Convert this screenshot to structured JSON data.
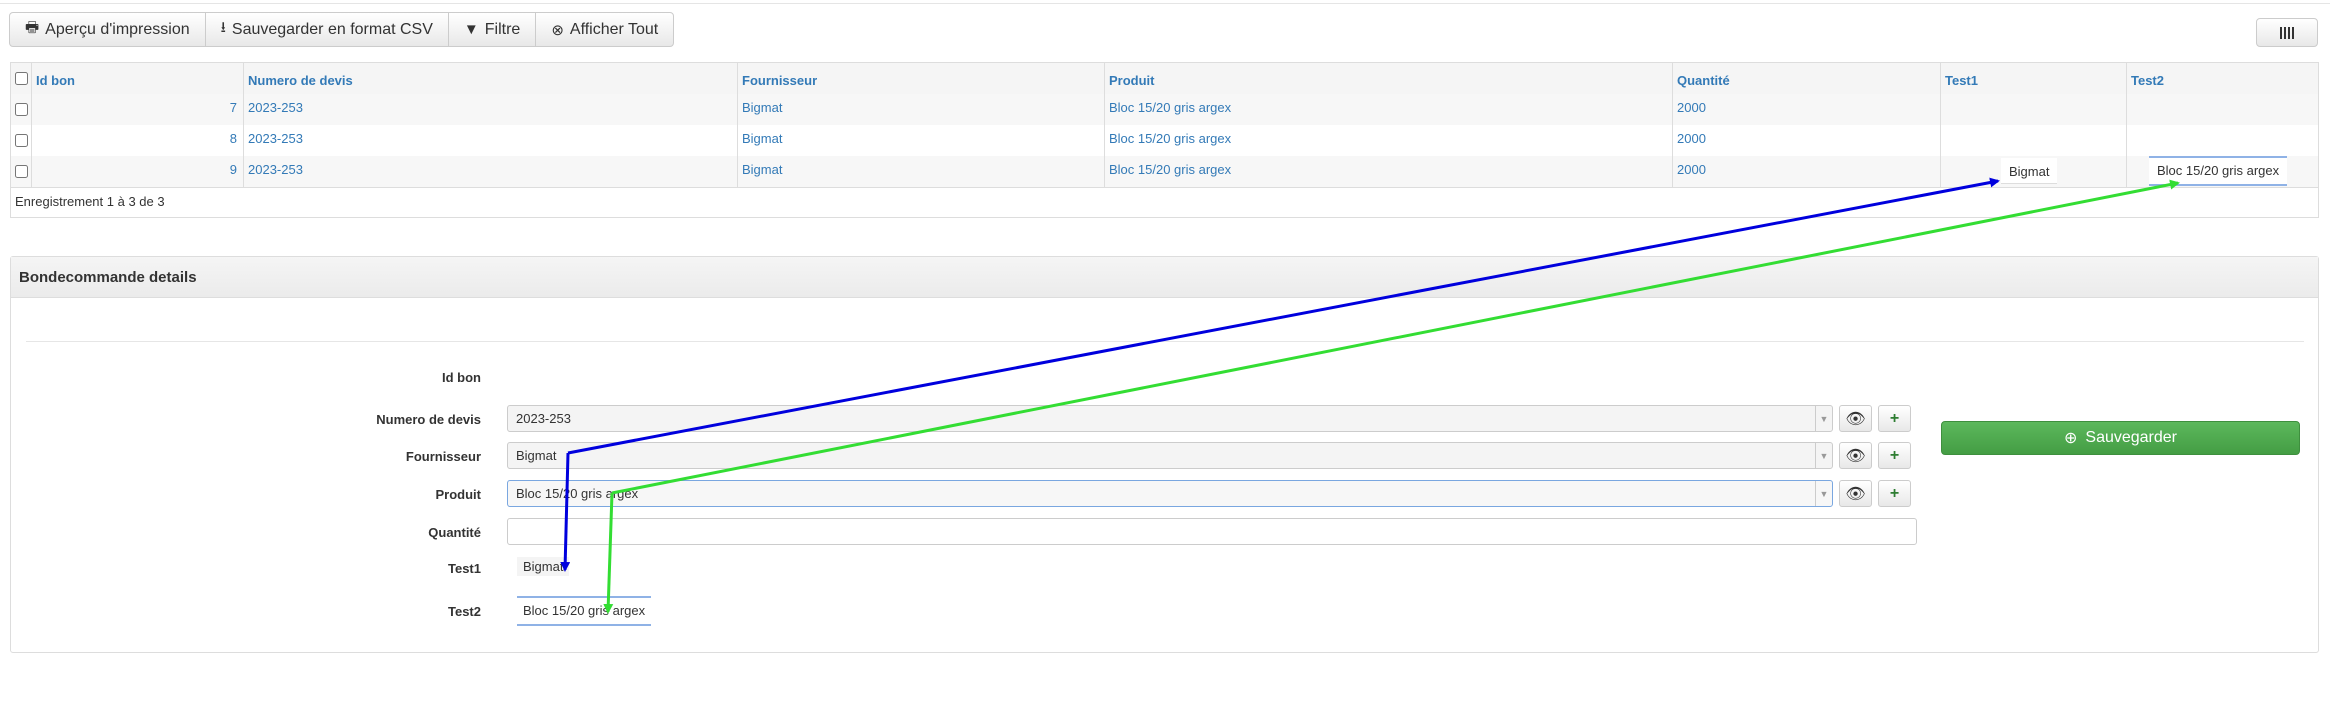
{
  "toolbar": {
    "print_label": "Aperçu d'impression",
    "csv_label": "Sauvegarder en format CSV",
    "filter_label": "Filtre",
    "show_all_label": "Afficher Tout",
    "columns_icon": "columns-icon"
  },
  "grid": {
    "columns": [
      "Id bon",
      "Numero de devis",
      "Fournisseur",
      "Produit",
      "Quantité",
      "Test1",
      "Test2"
    ],
    "rows": [
      {
        "id": "7",
        "devis": "2023-253",
        "fournisseur": "Bigmat",
        "produit": "Bloc 15/20 gris argex",
        "quantite": "2000",
        "test1": "",
        "test2": ""
      },
      {
        "id": "8",
        "devis": "2023-253",
        "fournisseur": "Bigmat",
        "produit": "Bloc 15/20 gris argex",
        "quantite": "2000",
        "test1": "",
        "test2": ""
      },
      {
        "id": "9",
        "devis": "2023-253",
        "fournisseur": "Bigmat",
        "produit": "Bloc 15/20 gris argex",
        "quantite": "2000",
        "test1": "Bigmat",
        "test2": "Bloc 15/20 gris argex"
      }
    ],
    "record_count": "Enregistrement 1 à 3 de 3"
  },
  "panel": {
    "title": "Bondecommande details",
    "labels": {
      "id_bon": "Id bon",
      "devis": "Numero de devis",
      "fournisseur": "Fournisseur",
      "produit": "Produit",
      "quantite": "Quantité",
      "test1": "Test1",
      "test2": "Test2"
    },
    "values": {
      "devis": "2023-253",
      "fournisseur": "Bigmat",
      "produit": "Bloc 15/20 gris argex",
      "quantite": "",
      "test1": "Bigmat",
      "test2": "Bloc 15/20 gris argex"
    },
    "save_label": "Sauvegarder"
  },
  "colors": {
    "link": "#337ab7",
    "save_green": "#5cb85c",
    "arrow_blue": "#0000dd",
    "arrow_green": "#33dd33"
  }
}
